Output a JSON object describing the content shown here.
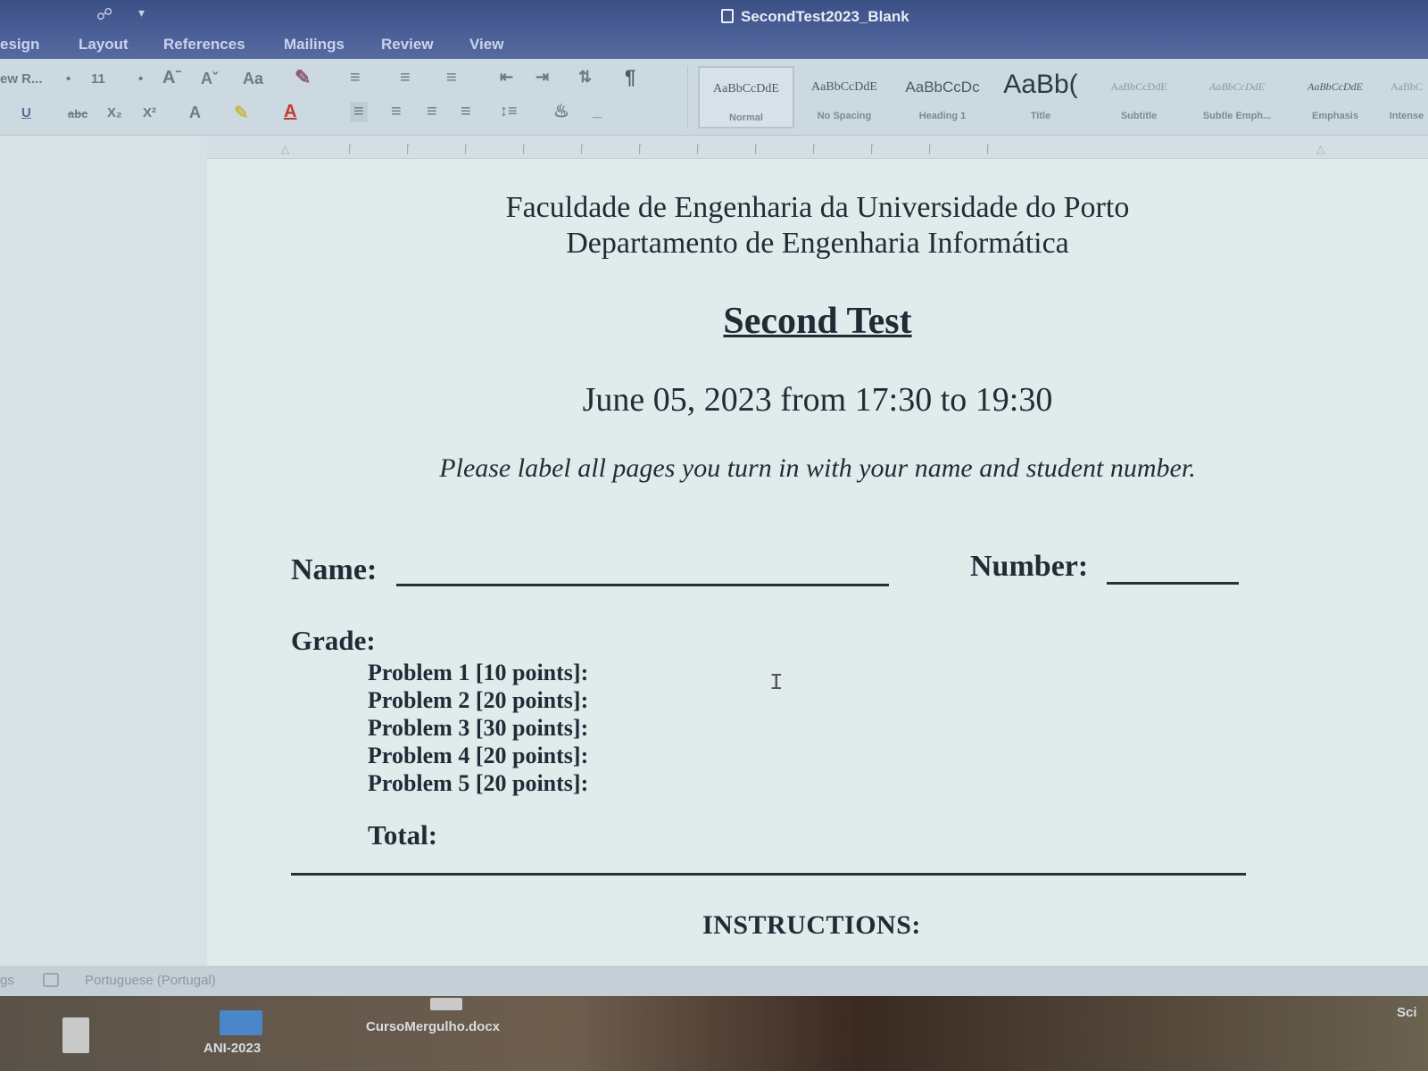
{
  "window": {
    "title": "SecondTest2023_Blank"
  },
  "tabs": [
    "esign",
    "Layout",
    "References",
    "Mailings",
    "Review",
    "View"
  ],
  "ribbon": {
    "font_name": "ew R...",
    "font_size": "11",
    "styles": [
      {
        "preview": "AaBbCcDdE",
        "name": "Normal"
      },
      {
        "preview": "AaBbCcDdE",
        "name": "No Spacing"
      },
      {
        "preview": "AaBbCcDc",
        "name": "Heading 1"
      },
      {
        "preview": "AaBb(",
        "name": "Title"
      },
      {
        "preview": "AaBbCcDdE",
        "name": "Subtitle"
      },
      {
        "preview": "AaBbCcDdE",
        "name": "Subtle Emph..."
      },
      {
        "preview": "AaBbCcDdE",
        "name": "Emphasis"
      },
      {
        "preview": "AaBbC",
        "name": "Intense"
      }
    ]
  },
  "document": {
    "institution": "Faculdade de Engenharia da Universidade do Porto",
    "department": "Departamento de Engenharia Informática",
    "test_title": "Second Test",
    "datetime": "June 05, 2023 from 17:30 to 19:30",
    "note": "Please label all pages you turn in with your name and student number.",
    "name_label": "Name:",
    "number_label": "Number:",
    "grade_label": "Grade:",
    "problems": [
      "Problem 1 [10 points]:",
      "Problem 2 [20 points]:",
      "Problem 3 [30 points]:",
      "Problem 4 [20 points]:",
      "Problem 5 [20 points]:"
    ],
    "total_label": "Total:",
    "instructions_label": "INSTRUCTIONS:"
  },
  "statusbar": {
    "left": "gs",
    "language": "Portuguese (Portugal)"
  },
  "taskbar": {
    "items": [
      "ANI-2023",
      "CursoMergulho.docx",
      "Sci"
    ]
  }
}
